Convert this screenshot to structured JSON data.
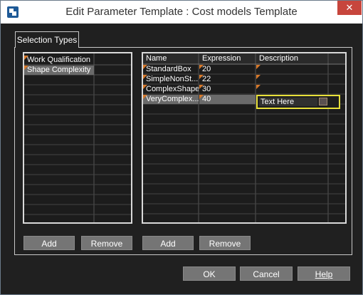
{
  "window": {
    "title": "Edit Parameter Template : Cost models Template",
    "close_glyph": "✕",
    "icons": {
      "app": "app-logo-icon",
      "close": "close-icon",
      "cell_flag": "orange-triangle-icon",
      "checkbox": "checkbox-icon"
    }
  },
  "tab": {
    "label": "Selection Types"
  },
  "left_list": {
    "items": [
      "Work Qualification",
      "Shape Complexity"
    ],
    "selected": "Shape Complexity"
  },
  "right_table": {
    "columns": [
      "Name",
      "Expression",
      "Description"
    ],
    "rows": [
      {
        "name": "StandardBox",
        "expression": "20",
        "description": ""
      },
      {
        "name": "SimpleNonSt...",
        "expression": "22",
        "description": ""
      },
      {
        "name": "ComplexShape",
        "expression": "30",
        "description": ""
      },
      {
        "name": "VeryComplex...",
        "expression": "40",
        "description": "Text Here"
      }
    ],
    "editing_text": "Text Here"
  },
  "buttons": {
    "left_add": "Add",
    "left_remove": "Remove",
    "right_add": "Add",
    "right_remove": "Remove",
    "ok": "OK",
    "cancel": "Cancel",
    "help": "Help"
  },
  "colors": {
    "accent_highlight": "#e8e03a",
    "cell_marker": "#d6782a",
    "close": "#c7463d"
  }
}
